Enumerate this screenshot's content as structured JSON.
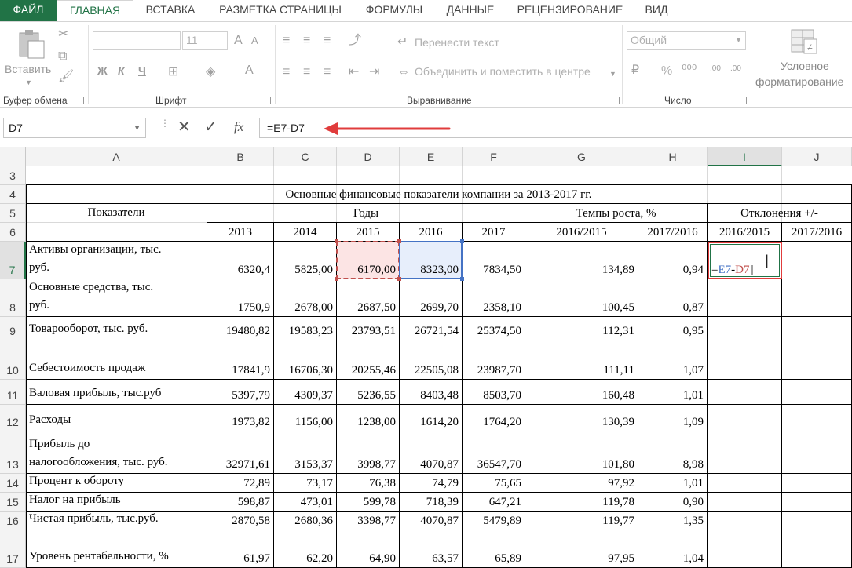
{
  "ribbon_tabs": [
    "ФАЙЛ",
    "ГЛАВНАЯ",
    "ВСТАВКА",
    "РАЗМЕТКА СТРАНИЦЫ",
    "ФОРМУЛЫ",
    "ДАННЫЕ",
    "РЕЦЕНЗИРОВАНИЕ",
    "ВИД"
  ],
  "ribbon": {
    "paste_label": "Вставить",
    "font_size": "11",
    "bold": "Ж",
    "italic": "К",
    "underline": "Ч",
    "wrap_text": "Перенести текст",
    "merge_center": "Объединить и поместить в центре",
    "number_format": "Общий",
    "percent": "%",
    "cond_format_line1": "Условное",
    "cond_format_line2": "форматирование",
    "group_clipboard": "Буфер обмена",
    "group_font": "Шрифт",
    "group_alignment": "Выравнивание",
    "group_number": "Число"
  },
  "formula_bar": {
    "name_box": "D7",
    "fx": "fx",
    "formula": "=E7-D7"
  },
  "columns": [
    "A",
    "B",
    "C",
    "D",
    "E",
    "F",
    "G",
    "H",
    "I",
    "J"
  ],
  "rows": [
    "3",
    "4",
    "5",
    "6",
    "7",
    "8",
    "9",
    "10",
    "11",
    "12",
    "13",
    "14",
    "15",
    "16",
    "17"
  ],
  "sheet": {
    "title": "Основные финансовые показатели компании за 2013-2017 гг.",
    "hdr_indicators": "Показатели",
    "hdr_years": "Годы",
    "hdr_growth": "Темпы роста, %",
    "hdr_deviation": "Отклонения +/-",
    "years": [
      "2013",
      "2014",
      "2015",
      "2016",
      "2017"
    ],
    "growth_cols": [
      "2016/2015",
      "2017/2016"
    ],
    "dev_cols": [
      "2016/2015",
      "2017/2016"
    ],
    "edit_formula": {
      "eq": "=",
      "ref1": "E7",
      "minus": "-",
      "ref2": "D7"
    },
    "data": [
      {
        "row": "7",
        "label": [
          "Активы организации, тыс.",
          "руб."
        ],
        "vals": [
          "6320,4",
          "5825,00",
          "6170,00",
          "8323,00",
          "7834,50"
        ],
        "g": [
          "134,89",
          "0,94"
        ]
      },
      {
        "row": "8",
        "label": [
          "Основные средства, тыс.",
          "руб."
        ],
        "vals": [
          "1750,9",
          "2678,00",
          "2687,50",
          "2699,70",
          "2358,10"
        ],
        "g": [
          "100,45",
          "0,87"
        ]
      },
      {
        "row": "9",
        "label": [
          "Товарооборот, тыс. руб."
        ],
        "vals": [
          "19480,82",
          "19583,23",
          "23793,51",
          "26721,54",
          "25374,50"
        ],
        "g": [
          "112,31",
          "0,95"
        ]
      },
      {
        "row": "10",
        "label": [
          "Себестоимость продаж"
        ],
        "vals": [
          "17841,9",
          "16706,30",
          "20255,46",
          "22505,08",
          "23987,70"
        ],
        "g": [
          "111,11",
          "1,07"
        ]
      },
      {
        "row": "11",
        "label": [
          "Валовая прибыль, тыс.руб"
        ],
        "vals": [
          "5397,79",
          "4309,37",
          "5236,55",
          "8403,48",
          "8503,70"
        ],
        "g": [
          "160,48",
          "1,01"
        ]
      },
      {
        "row": "12",
        "label": [
          "Расходы"
        ],
        "vals": [
          "1973,82",
          "1156,00",
          "1238,00",
          "1614,20",
          "1764,20"
        ],
        "g": [
          "130,39",
          "1,09"
        ]
      },
      {
        "row": "13",
        "label": [
          "Прибыль до",
          "налогообложения, тыс. руб."
        ],
        "vals": [
          "32971,61",
          "3153,37",
          "3998,77",
          "4070,87",
          "36547,70"
        ],
        "g": [
          "101,80",
          "8,98"
        ]
      },
      {
        "row": "14",
        "label": [
          "Процент к обороту"
        ],
        "vals": [
          "72,89",
          "73,17",
          "76,38",
          "74,79",
          "75,65"
        ],
        "g": [
          "97,92",
          "1,01"
        ]
      },
      {
        "row": "15",
        "label": [
          "Налог на прибыль"
        ],
        "vals": [
          "598,87",
          "473,01",
          "599,78",
          "718,39",
          "647,21"
        ],
        "g": [
          "119,78",
          "0,90"
        ]
      },
      {
        "row": "16",
        "label": [
          "Чистая прибыль, тыс.руб."
        ],
        "vals": [
          "2870,58",
          "2680,36",
          "3398,77",
          "4070,87",
          "5479,89"
        ],
        "g": [
          "119,77",
          "1,35"
        ]
      },
      {
        "row": "17",
        "label": [
          "Уровень рентабельности, %"
        ],
        "vals": [
          "61,97",
          "62,20",
          "64,90",
          "63,57",
          "65,89"
        ],
        "g": [
          "97,95",
          "1,04"
        ]
      }
    ]
  },
  "colors": {
    "accent": "#217346",
    "ref_blue": "#4472c4",
    "ref_red": "#e06666",
    "highlight": "#e03c3c"
  }
}
